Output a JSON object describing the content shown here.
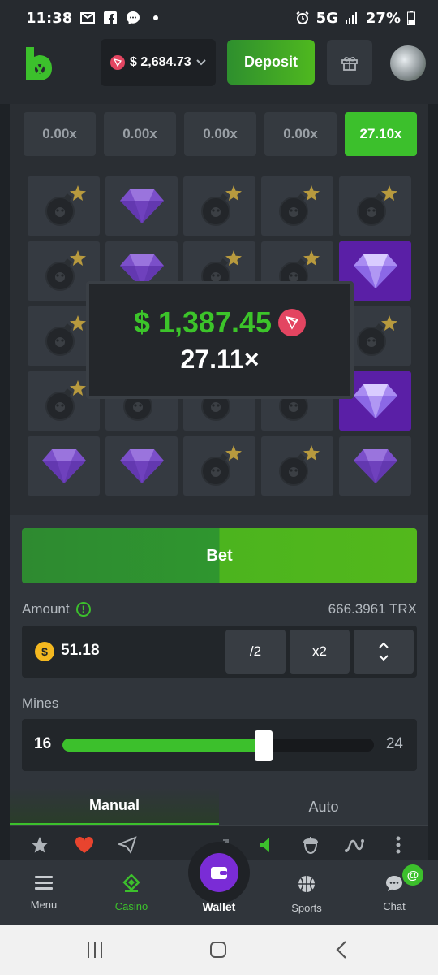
{
  "status_bar": {
    "time": "11:38",
    "network": "5G",
    "battery": "27%"
  },
  "header": {
    "balance": "$ 2,684.73",
    "deposit_label": "Deposit"
  },
  "multipliers": [
    {
      "label": "0.00x",
      "active": false
    },
    {
      "label": "0.00x",
      "active": false
    },
    {
      "label": "0.00x",
      "active": false
    },
    {
      "label": "0.00x",
      "active": false
    },
    {
      "label": "27.10x",
      "active": true
    }
  ],
  "grid": [
    "bomb",
    "gem",
    "bomb",
    "bomb",
    "bomb",
    "bomb",
    "gem",
    "bomb",
    "bomb",
    "gem-hit",
    "bomb",
    "gem",
    "bomb",
    "bomb",
    "bomb",
    "bomb",
    "bomb",
    "bomb",
    "bomb",
    "gem-hit",
    "gem",
    "gem",
    "bomb",
    "bomb",
    "gem"
  ],
  "win": {
    "amount": "$ 1,387.45",
    "multiplier": "27.11×"
  },
  "controls": {
    "bet_label": "Bet",
    "amount_label": "Amount",
    "amount_trx": "666.3961 TRX",
    "amount_value": "51.18",
    "half_label": "/2",
    "double_label": "x2",
    "mines_label": "Mines",
    "mines_value": "16",
    "mines_max": "24",
    "mines_fraction": 0.647
  },
  "tabs": {
    "manual": "Manual",
    "auto": "Auto"
  },
  "nav": {
    "menu": "Menu",
    "casino": "Casino",
    "wallet": "Wallet",
    "sports": "Sports",
    "chat": "Chat"
  },
  "colors": {
    "accent_green": "#3cc02c",
    "gem_purple": "#5a1fa6",
    "trx_red": "#e34561"
  }
}
